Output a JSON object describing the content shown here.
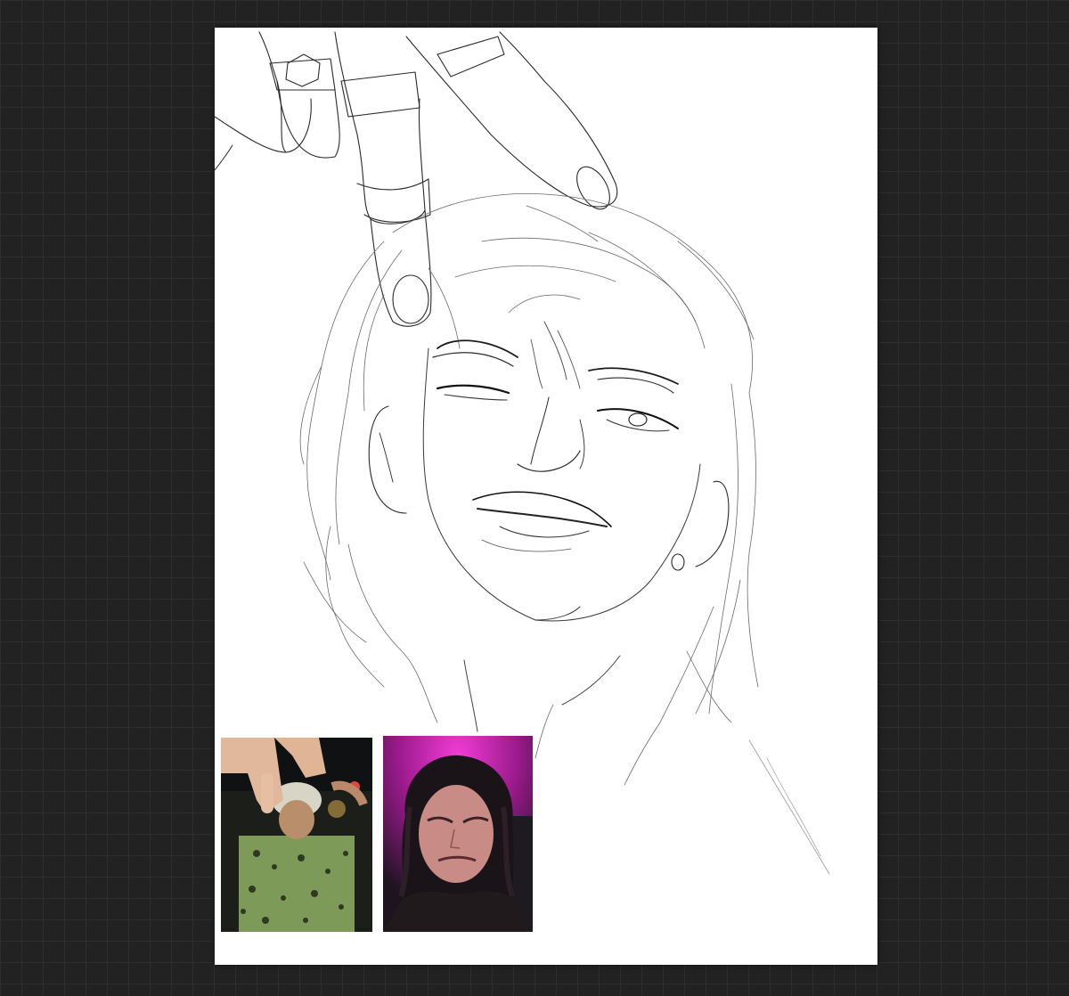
{
  "app": {
    "background_color": "#222222",
    "grid_color": "#2e2e2e",
    "canvas_color": "#ffffff"
  },
  "canvas": {
    "content": "line-art sketch",
    "sketch_icon": "portrait-sketch-icon"
  },
  "reference_images": [
    {
      "name": "reference-photo-1",
      "accent": "#9cbf6a"
    },
    {
      "name": "reference-photo-2",
      "accent": "#d21fb8"
    }
  ]
}
